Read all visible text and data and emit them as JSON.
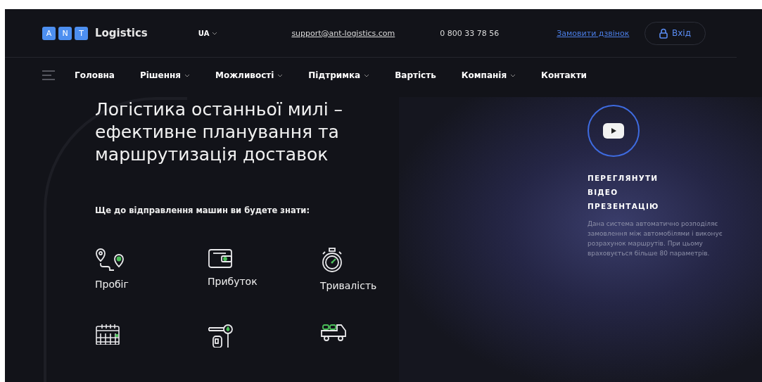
{
  "logo": {
    "letters": [
      "A",
      "N",
      "T"
    ],
    "name": "Logistics"
  },
  "header": {
    "language": "UA",
    "email": "support@ant-logistics.com",
    "phone": "0 800 33 78 56",
    "callback_link": "Замовити дзвінок",
    "login_button": "Вхід"
  },
  "nav": [
    {
      "label": "Головна",
      "dropdown": false
    },
    {
      "label": "Рішення",
      "dropdown": true
    },
    {
      "label": "Можливості",
      "dropdown": true
    },
    {
      "label": "Підтримка",
      "dropdown": true
    },
    {
      "label": "Вартість",
      "dropdown": false
    },
    {
      "label": "Компанія",
      "dropdown": true
    },
    {
      "label": "Контакти",
      "dropdown": false
    }
  ],
  "hero": {
    "title": "Логістика останньої милі – ефективне планування та маршрутизація доставок",
    "subtitle": "Ще до відправлення машин ви будете знати:"
  },
  "features": [
    {
      "kind": "route",
      "label": "Пробіг"
    },
    {
      "kind": "wallet",
      "label": "Прибуток"
    },
    {
      "kind": "stopwatch",
      "label": "Тривалість"
    },
    {
      "kind": "calendar"
    },
    {
      "kind": "fuel"
    },
    {
      "kind": "truck"
    }
  ],
  "video": {
    "heading_lines": [
      "ПЕРЕГЛЯНУТИ",
      "ВІДЕО",
      "ПРЕЗЕНТАЦІЮ"
    ],
    "description": "Дана система автоматично розподіляє замовлення між автомобілями і виконує розрахунок маршрутів. При цьому враховується більше 80 параметрів."
  }
}
